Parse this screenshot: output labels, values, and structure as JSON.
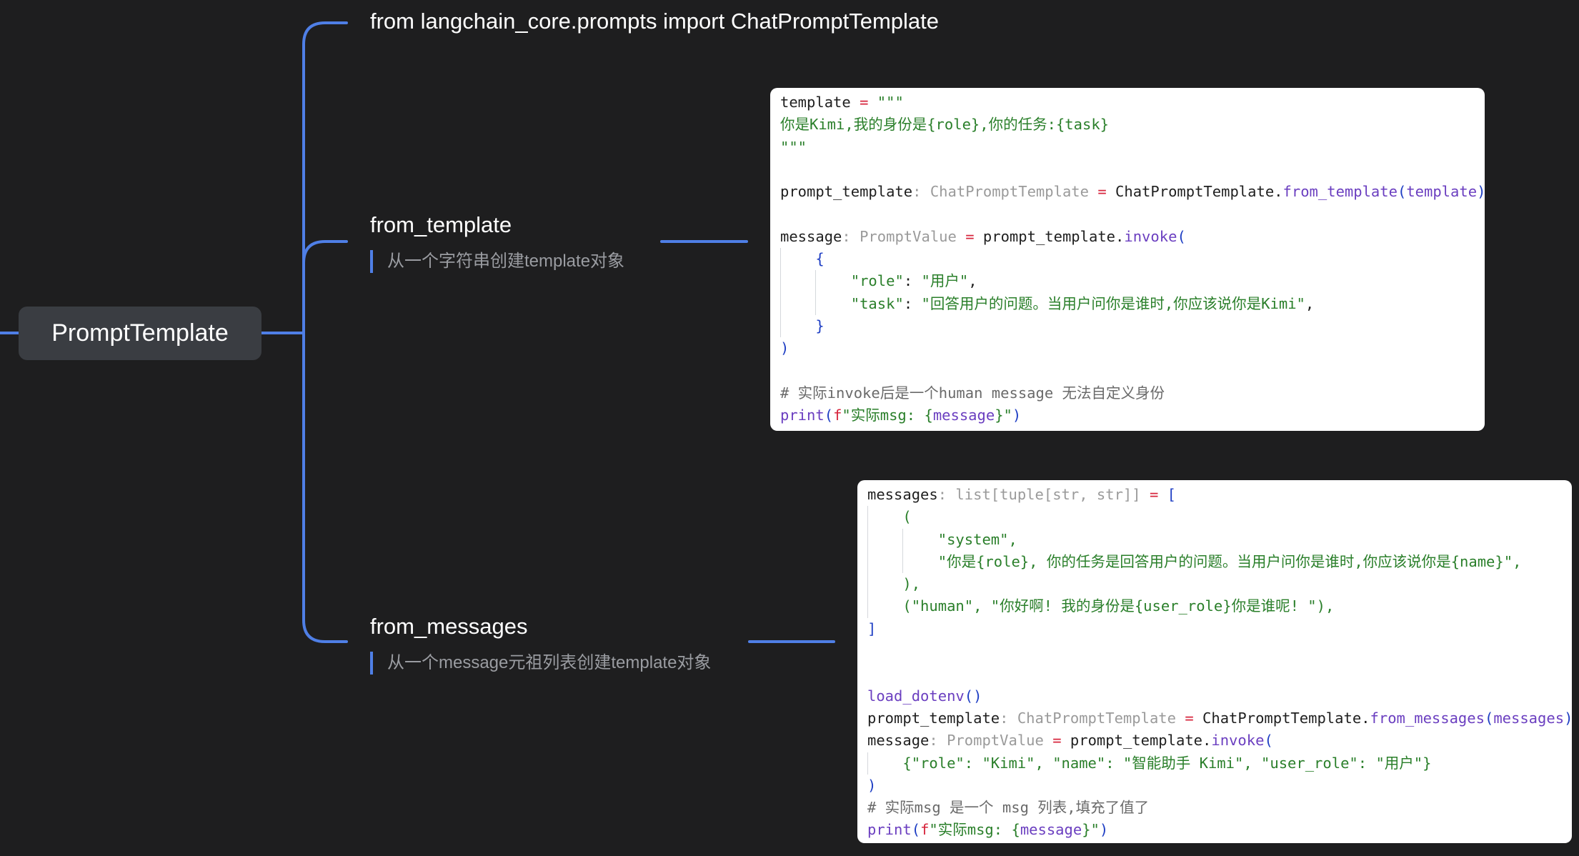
{
  "mindmap": {
    "root": {
      "label": "PromptTemplate"
    },
    "import_line": "from langchain_core.prompts import ChatPromptTemplate",
    "branches": [
      {
        "title": "from_template",
        "note": "从一个字符串创建template对象"
      },
      {
        "title": "from_messages",
        "note": "从一个message元祖列表创建template对象"
      }
    ],
    "colors": {
      "background": "#1e1e1f",
      "connector": "#4f7fe6",
      "root_fill": "#3a3d42",
      "code_bg": "#ffffff"
    }
  },
  "code_from_template": {
    "l1": {
      "a": "template",
      "b": " = ",
      "c": "\"\"\""
    },
    "l2": "你是Kimi,我的身份是{role},你的任务:{task}",
    "l3": "\"\"\"",
    "l5": {
      "a": "prompt_template",
      "b": ": ChatPromptTemplate",
      "c": " = ",
      "d": "ChatPromptTemplate.",
      "e": "from_template",
      "f": "(",
      "g": "template",
      "h": ")"
    },
    "l7": {
      "a": "message",
      "b": ": PromptValue",
      "c": " = ",
      "d": "prompt_template.",
      "e": "invoke",
      "f": "("
    },
    "l8": "{",
    "l9": {
      "k": "\"role\"",
      "sep": ": ",
      "v": "\"用户\"",
      "end": ","
    },
    "l10": {
      "k": "\"task\"",
      "sep": ": ",
      "v": "\"回答用户的问题。当用户问你是谁时,你应该说你是Kimi\"",
      "end": ","
    },
    "l11": "}",
    "l12": ")",
    "l14": "# 实际invoke后是一个human message 无法自定义身份",
    "l15": {
      "fn": "print",
      "p": "(",
      "f": "f",
      "s1": "\"实际msg: {",
      "var": "message",
      "s2": "}\"",
      "p2": ")"
    }
  },
  "code_from_messages": {
    "l1": {
      "a": "messages",
      "b": ": list[tuple[str, str]]",
      "c": " = ",
      "d": "["
    },
    "l2": "(",
    "l3": "\"system\",",
    "l4": "\"你是{role}, 你的任务是回答用户的问题。当用户问你是谁时,你应该说你是{name}\",",
    "l5": "),",
    "l6": "(\"human\", \"你好啊! 我的身份是{user_role}你是谁呢! \"),",
    "l7": "]",
    "l10": {
      "fn": "load_dotenv",
      "p": "()"
    },
    "l11": {
      "a": "prompt_template",
      "b": ": ChatPromptTemplate",
      "c": " = ",
      "d": "ChatPromptTemplate.",
      "e": "from_messages",
      "f": "(",
      "g": "messages",
      "h": ")"
    },
    "l12": {
      "a": "message",
      "b": ": PromptValue",
      "c": " = ",
      "d": "prompt_template.",
      "e": "invoke",
      "f": "("
    },
    "l13": "{\"role\": \"Kimi\", \"name\": \"智能助手 Kimi\", \"user_role\": \"用户\"}",
    "l14": ")",
    "l15": "# 实际msg 是一个 msg 列表,填充了值了",
    "l16": {
      "fn": "print",
      "p": "(",
      "f": "f",
      "s1": "\"实际msg: {",
      "var": "message",
      "s2": "}\"",
      "p2": ")"
    }
  }
}
